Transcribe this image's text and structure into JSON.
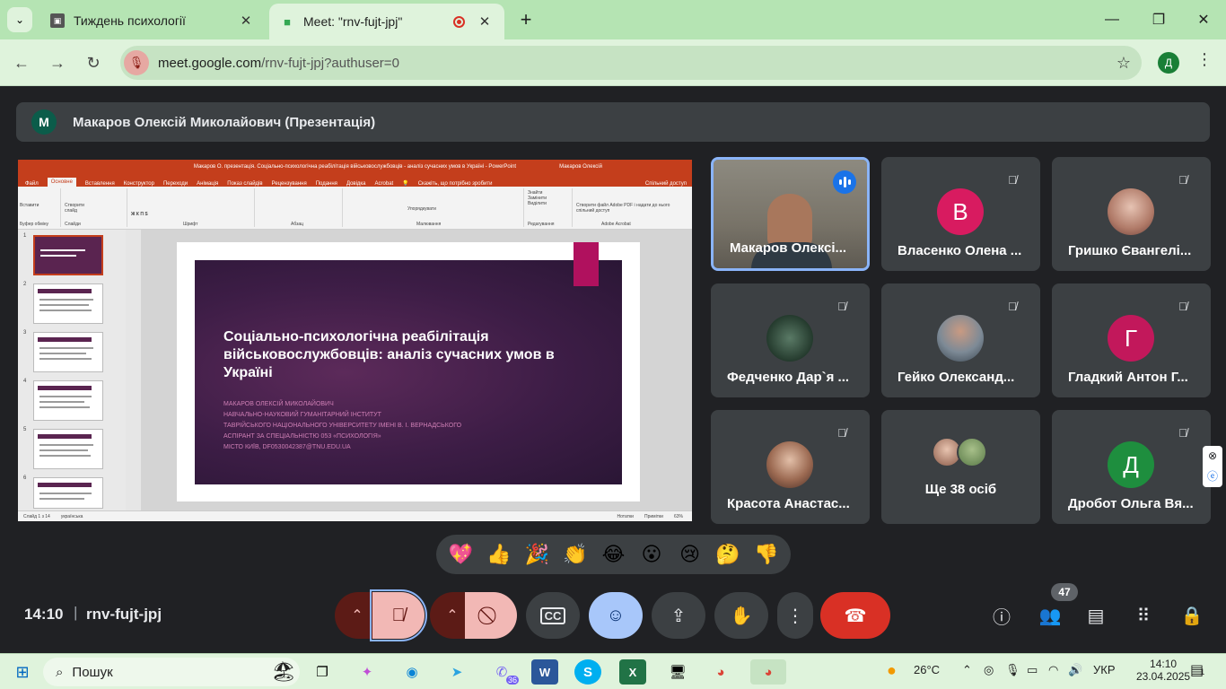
{
  "browser": {
    "tabs": [
      {
        "title": "Тиждень психології",
        "active": false
      },
      {
        "title": "Meet: \"rnv-fujt-jpj\"",
        "active": true
      }
    ],
    "url_host": "meet.google.com",
    "url_path": "/rnv-fujt-jpj?authuser=0",
    "profile_initial": "Д"
  },
  "presenter_bar": {
    "initial": "M",
    "name": "Макаров Олексій Миколайович (Презентація)"
  },
  "ppt": {
    "window_title": "Макаров О. презентація. Соціально-психологічна реабілітація військовослужбовців - аналіз сучасних умов в Україні  -  PowerPoint",
    "user": "Макаров Олексій",
    "menus": [
      "Файл",
      "Основне",
      "Вставлення",
      "Конструктор",
      "Переходи",
      "Анімація",
      "Показ слайдів",
      "Рецензування",
      "Подання",
      "Довідка",
      "Acrobat"
    ],
    "tell_me": "Скажіть, що потрібно зробити",
    "share": "Спільний доступ",
    "ribbon_groups": [
      "Буфер обміну",
      "Слайди",
      "Шрифт",
      "Абзац",
      "Малювання",
      "Редагування",
      "Adobe Acrobat"
    ],
    "ribbon_buttons": {
      "paste": "Вставити",
      "new_slide": "Створити слайд",
      "find": "Знайти",
      "replace": "Замінити",
      "select": "Виділити",
      "arrange": "Упорядкувати",
      "acrobat": "Створити файл Adobe PDF і надати до нього спільний доступ"
    },
    "thumb_numbers": [
      "1",
      "2",
      "3",
      "4",
      "5",
      "6"
    ],
    "slide": {
      "title": "Соціально-психологічна реабілітація військовослужбовців: аналіз сучасних умов в Україні",
      "lines": [
        "Макаров Олексій Миколайович",
        "Навчально-науковий гуманітарний інститут",
        "Таврійського національного університету імені В. І. Вернадського",
        "аспірант за спеціальністю 053 «Психологія»",
        "місто Київ, DF0530042387@TNU.EDU.UA"
      ]
    },
    "status": {
      "slide": "Слайд 1 з 14",
      "lang": "українська",
      "notes": "Нотатки",
      "comments": "Примітки",
      "zoom": "63%"
    }
  },
  "tiles": [
    {
      "name": "Макаров Олексі...",
      "type": "camera",
      "speaking": true
    },
    {
      "name": "Власенко Олена ...",
      "type": "letter",
      "letter": "В",
      "color": "#d81b60",
      "muted": true
    },
    {
      "name": "Гришко Євангелі...",
      "type": "photo",
      "color": "#c59b8d",
      "muted": true
    },
    {
      "name": "Федченко Дар`я ...",
      "type": "photo",
      "color": "#2f4a3a",
      "muted": true
    },
    {
      "name": "Гейко Олександ...",
      "type": "photo",
      "color": "#6d7a86",
      "muted": true
    },
    {
      "name": "Гладкий Антон Г...",
      "type": "letter",
      "letter": "Г",
      "color": "#c2185b",
      "muted": true
    },
    {
      "name": "Красота Анастас...",
      "type": "photo",
      "color": "#b48a76",
      "muted": true
    },
    {
      "name": "Ще 38 осіб",
      "type": "more"
    },
    {
      "name": "Дробот Ольга Вя...",
      "type": "letter",
      "letter": "Д",
      "color": "#1e8e3e",
      "muted": true
    }
  ],
  "reactions": [
    "💖",
    "👍",
    "🎉",
    "👏",
    "😂",
    "😮",
    "😢",
    "🤔",
    "👎"
  ],
  "meeting": {
    "time": "14:10",
    "code": "rnv-fujt-jpj",
    "participants": "47"
  },
  "taskbar": {
    "search": "Пошук",
    "weather": "26°C",
    "lang": "УКР",
    "time": "14:10",
    "date": "23.04.2025",
    "viber_badge": "36",
    "notifications": "1"
  }
}
